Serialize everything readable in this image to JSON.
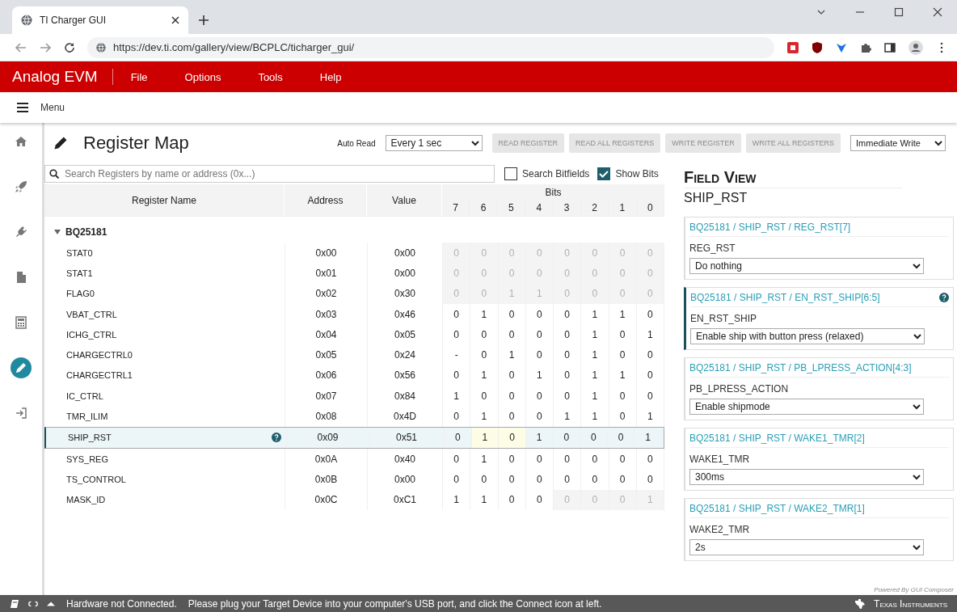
{
  "browser": {
    "tab_title": "TI Charger GUI",
    "url": "https://dev.ti.com/gallery/view/BCPLC/ticharger_gui/"
  },
  "app": {
    "title": "Analog EVM",
    "menus": [
      "File",
      "Options",
      "Tools",
      "Help"
    ],
    "menu_button": "Menu"
  },
  "sidebar": {
    "items": [
      {
        "selected": false
      },
      {
        "selected": false
      },
      {
        "selected": false
      },
      {
        "selected": false
      },
      {
        "selected": false
      },
      {
        "selected": true
      },
      {
        "selected": false
      }
    ]
  },
  "register_map": {
    "title": "Register Map",
    "auto_read": {
      "label": "Auto Read",
      "value": "Every 1 sec"
    },
    "buttons": [
      {
        "label": "READ REGISTER",
        "disabled": true
      },
      {
        "label": "READ ALL REGISTERS",
        "disabled": true
      },
      {
        "label": "WRITE REGISTER",
        "disabled": true
      },
      {
        "label": "WRITE ALL REGISTERS",
        "disabled": true
      }
    ],
    "write_mode": "Immediate Write",
    "search": {
      "placeholder": "Search Registers by name or address (0x...)"
    },
    "checkboxes": [
      {
        "label": "Search Bitfields",
        "checked": false
      },
      {
        "label": "Show Bits",
        "checked": true
      }
    ],
    "columns": [
      "Register Name",
      "Address",
      "Value"
    ],
    "bits_label": "Bits",
    "bit_numbers": [
      "7",
      "6",
      "5",
      "4",
      "3",
      "2",
      "1",
      "0"
    ],
    "group": {
      "name": "BQ25181",
      "expanded": true
    },
    "rows": [
      {
        "name": "STAT0",
        "address": "0x00",
        "value": "0x00",
        "selected": false,
        "help": false,
        "bits": [
          {
            "value": "0",
            "readonly": true,
            "highlighted": false
          },
          {
            "value": "0",
            "readonly": true,
            "highlighted": false
          },
          {
            "value": "0",
            "readonly": true,
            "highlighted": false
          },
          {
            "value": "0",
            "readonly": true,
            "highlighted": false
          },
          {
            "value": "0",
            "readonly": true,
            "highlighted": false
          },
          {
            "value": "0",
            "readonly": true,
            "highlighted": false
          },
          {
            "value": "0",
            "readonly": true,
            "highlighted": false
          },
          {
            "value": "0",
            "readonly": true,
            "highlighted": false
          }
        ]
      },
      {
        "name": "STAT1",
        "address": "0x01",
        "value": "0x00",
        "selected": false,
        "help": false,
        "bits": [
          {
            "value": "0",
            "readonly": true,
            "highlighted": false
          },
          {
            "value": "0",
            "readonly": true,
            "highlighted": false
          },
          {
            "value": "0",
            "readonly": true,
            "highlighted": false
          },
          {
            "value": "0",
            "readonly": true,
            "highlighted": false
          },
          {
            "value": "0",
            "readonly": true,
            "highlighted": false
          },
          {
            "value": "0",
            "readonly": true,
            "highlighted": false
          },
          {
            "value": "0",
            "readonly": true,
            "highlighted": false
          },
          {
            "value": "0",
            "readonly": true,
            "highlighted": false
          }
        ]
      },
      {
        "name": "FLAG0",
        "address": "0x02",
        "value": "0x30",
        "selected": false,
        "help": false,
        "bits": [
          {
            "value": "0",
            "readonly": true,
            "highlighted": false
          },
          {
            "value": "0",
            "readonly": true,
            "highlighted": false
          },
          {
            "value": "1",
            "readonly": true,
            "highlighted": false
          },
          {
            "value": "1",
            "readonly": true,
            "highlighted": false
          },
          {
            "value": "0",
            "readonly": true,
            "highlighted": false
          },
          {
            "value": "0",
            "readonly": true,
            "highlighted": false
          },
          {
            "value": "0",
            "readonly": true,
            "highlighted": false
          },
          {
            "value": "0",
            "readonly": true,
            "highlighted": false
          }
        ]
      },
      {
        "name": "VBAT_CTRL",
        "address": "0x03",
        "value": "0x46",
        "selected": false,
        "help": false,
        "bits": [
          {
            "value": "0",
            "readonly": false,
            "highlighted": false
          },
          {
            "value": "1",
            "readonly": false,
            "highlighted": false
          },
          {
            "value": "0",
            "readonly": false,
            "highlighted": false
          },
          {
            "value": "0",
            "readonly": false,
            "highlighted": false
          },
          {
            "value": "0",
            "readonly": false,
            "highlighted": false
          },
          {
            "value": "1",
            "readonly": false,
            "highlighted": false
          },
          {
            "value": "1",
            "readonly": false,
            "highlighted": false
          },
          {
            "value": "0",
            "readonly": false,
            "highlighted": false
          }
        ]
      },
      {
        "name": "ICHG_CTRL",
        "address": "0x04",
        "value": "0x05",
        "selected": false,
        "help": false,
        "bits": [
          {
            "value": "0",
            "readonly": false,
            "highlighted": false
          },
          {
            "value": "0",
            "readonly": false,
            "highlighted": false
          },
          {
            "value": "0",
            "readonly": false,
            "highlighted": false
          },
          {
            "value": "0",
            "readonly": false,
            "highlighted": false
          },
          {
            "value": "0",
            "readonly": false,
            "highlighted": false
          },
          {
            "value": "1",
            "readonly": false,
            "highlighted": false
          },
          {
            "value": "0",
            "readonly": false,
            "highlighted": false
          },
          {
            "value": "1",
            "readonly": false,
            "highlighted": false
          }
        ]
      },
      {
        "name": "CHARGECTRL0",
        "address": "0x05",
        "value": "0x24",
        "selected": false,
        "help": false,
        "bits": [
          {
            "value": "-",
            "readonly": false,
            "highlighted": false
          },
          {
            "value": "0",
            "readonly": false,
            "highlighted": false
          },
          {
            "value": "1",
            "readonly": false,
            "highlighted": false
          },
          {
            "value": "0",
            "readonly": false,
            "highlighted": false
          },
          {
            "value": "0",
            "readonly": false,
            "highlighted": false
          },
          {
            "value": "1",
            "readonly": false,
            "highlighted": false
          },
          {
            "value": "0",
            "readonly": false,
            "highlighted": false
          },
          {
            "value": "0",
            "readonly": false,
            "highlighted": false
          }
        ]
      },
      {
        "name": "CHARGECTRL1",
        "address": "0x06",
        "value": "0x56",
        "selected": false,
        "help": false,
        "bits": [
          {
            "value": "0",
            "readonly": false,
            "highlighted": false
          },
          {
            "value": "1",
            "readonly": false,
            "highlighted": false
          },
          {
            "value": "0",
            "readonly": false,
            "highlighted": false
          },
          {
            "value": "1",
            "readonly": false,
            "highlighted": false
          },
          {
            "value": "0",
            "readonly": false,
            "highlighted": false
          },
          {
            "value": "1",
            "readonly": false,
            "highlighted": false
          },
          {
            "value": "1",
            "readonly": false,
            "highlighted": false
          },
          {
            "value": "0",
            "readonly": false,
            "highlighted": false
          }
        ]
      },
      {
        "name": "IC_CTRL",
        "address": "0x07",
        "value": "0x84",
        "selected": false,
        "help": false,
        "bits": [
          {
            "value": "1",
            "readonly": false,
            "highlighted": false
          },
          {
            "value": "0",
            "readonly": false,
            "highlighted": false
          },
          {
            "value": "0",
            "readonly": false,
            "highlighted": false
          },
          {
            "value": "0",
            "readonly": false,
            "highlighted": false
          },
          {
            "value": "0",
            "readonly": false,
            "highlighted": false
          },
          {
            "value": "1",
            "readonly": false,
            "highlighted": false
          },
          {
            "value": "0",
            "readonly": false,
            "highlighted": false
          },
          {
            "value": "0",
            "readonly": false,
            "highlighted": false
          }
        ]
      },
      {
        "name": "TMR_ILIM",
        "address": "0x08",
        "value": "0x4D",
        "selected": false,
        "help": false,
        "bits": [
          {
            "value": "0",
            "readonly": false,
            "highlighted": false
          },
          {
            "value": "1",
            "readonly": false,
            "highlighted": false
          },
          {
            "value": "0",
            "readonly": false,
            "highlighted": false
          },
          {
            "value": "0",
            "readonly": false,
            "highlighted": false
          },
          {
            "value": "1",
            "readonly": false,
            "highlighted": false
          },
          {
            "value": "1",
            "readonly": false,
            "highlighted": false
          },
          {
            "value": "0",
            "readonly": false,
            "highlighted": false
          },
          {
            "value": "1",
            "readonly": false,
            "highlighted": false
          }
        ]
      },
      {
        "name": "SHIP_RST",
        "address": "0x09",
        "value": "0x51",
        "selected": true,
        "help": true,
        "bits": [
          {
            "value": "0",
            "readonly": false,
            "highlighted": false
          },
          {
            "value": "1",
            "readonly": false,
            "highlighted": true
          },
          {
            "value": "0",
            "readonly": false,
            "highlighted": true
          },
          {
            "value": "1",
            "readonly": false,
            "highlighted": false
          },
          {
            "value": "0",
            "readonly": false,
            "highlighted": false
          },
          {
            "value": "0",
            "readonly": false,
            "highlighted": false
          },
          {
            "value": "0",
            "readonly": false,
            "highlighted": false
          },
          {
            "value": "1",
            "readonly": false,
            "highlighted": false
          }
        ]
      },
      {
        "name": "SYS_REG",
        "address": "0x0A",
        "value": "0x40",
        "selected": false,
        "help": false,
        "bits": [
          {
            "value": "0",
            "readonly": false,
            "highlighted": false
          },
          {
            "value": "1",
            "readonly": false,
            "highlighted": false
          },
          {
            "value": "0",
            "readonly": false,
            "highlighted": false
          },
          {
            "value": "0",
            "readonly": false,
            "highlighted": false
          },
          {
            "value": "0",
            "readonly": false,
            "highlighted": false
          },
          {
            "value": "0",
            "readonly": false,
            "highlighted": false
          },
          {
            "value": "0",
            "readonly": false,
            "highlighted": false
          },
          {
            "value": "0",
            "readonly": false,
            "highlighted": false
          }
        ]
      },
      {
        "name": "TS_CONTROL",
        "address": "0x0B",
        "value": "0x00",
        "selected": false,
        "help": false,
        "bits": [
          {
            "value": "0",
            "readonly": false,
            "highlighted": false
          },
          {
            "value": "0",
            "readonly": false,
            "highlighted": false
          },
          {
            "value": "0",
            "readonly": false,
            "highlighted": false
          },
          {
            "value": "0",
            "readonly": false,
            "highlighted": false
          },
          {
            "value": "0",
            "readonly": false,
            "highlighted": false
          },
          {
            "value": "0",
            "readonly": false,
            "highlighted": false
          },
          {
            "value": "0",
            "readonly": false,
            "highlighted": false
          },
          {
            "value": "0",
            "readonly": false,
            "highlighted": false
          }
        ]
      },
      {
        "name": "MASK_ID",
        "address": "0x0C",
        "value": "0xC1",
        "selected": false,
        "help": false,
        "bits": [
          {
            "value": "1",
            "readonly": false,
            "highlighted": false
          },
          {
            "value": "1",
            "readonly": false,
            "highlighted": false
          },
          {
            "value": "0",
            "readonly": false,
            "highlighted": false
          },
          {
            "value": "0",
            "readonly": false,
            "highlighted": false
          },
          {
            "value": "0",
            "readonly": true,
            "highlighted": false
          },
          {
            "value": "0",
            "readonly": true,
            "highlighted": false
          },
          {
            "value": "0",
            "readonly": true,
            "highlighted": false
          },
          {
            "value": "1",
            "readonly": true,
            "highlighted": false
          }
        ]
      }
    ]
  },
  "field_view": {
    "title": "Field View",
    "register": "SHIP_RST",
    "fields": [
      {
        "path": "BQ25181 / SHIP_RST / REG_RST[7]",
        "name": "REG_RST",
        "value": "Do nothing",
        "selected": false
      },
      {
        "path": "BQ25181 / SHIP_RST / EN_RST_SHIP[6:5]",
        "name": "EN_RST_SHIP",
        "value": "Enable ship with button press (relaxed)",
        "selected": true
      },
      {
        "path": "BQ25181 / SHIP_RST / PB_LPRESS_ACTION[4:3]",
        "name": "PB_LPRESS_ACTION",
        "value": "Enable shipmode",
        "selected": false
      },
      {
        "path": "BQ25181 / SHIP_RST / WAKE1_TMR[2]",
        "name": "WAKE1_TMR",
        "value": "300ms",
        "selected": false
      },
      {
        "path": "BQ25181 / SHIP_RST / WAKE2_TMR[1]",
        "name": "WAKE2_TMR",
        "value": "2s",
        "selected": false
      }
    ]
  },
  "footer": {
    "powered": "Powered By GUI Composer"
  },
  "status_bar": {
    "message": "Hardware not Connected.",
    "hint": "Please plug your Target Device into your computer's USB port, and click the Connect icon at left.",
    "brand": "Texas Instruments"
  }
}
